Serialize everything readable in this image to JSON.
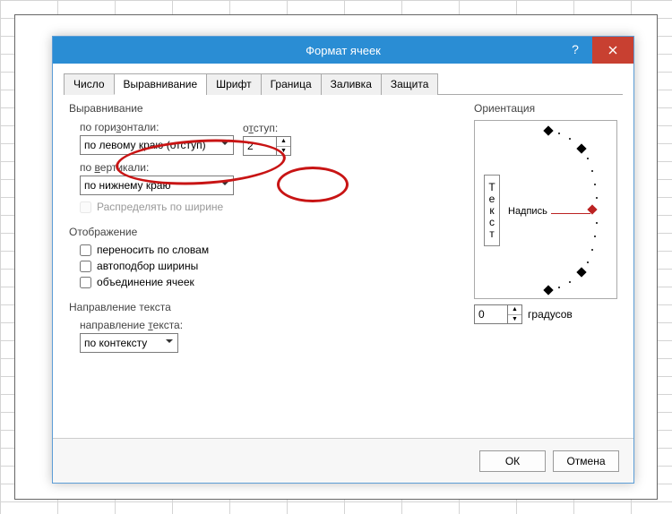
{
  "dialog": {
    "title": "Формат ячеек",
    "help": "?",
    "tabs": [
      "Число",
      "Выравнивание",
      "Шрифт",
      "Граница",
      "Заливка",
      "Защита"
    ],
    "active_tab": 1
  },
  "alignment": {
    "legend": "Выравнивание",
    "horiz_label": "по горизонтали:",
    "horiz_value": "по левому краю (отступ)",
    "indent_label": "отступ:",
    "indent_value": "2",
    "vert_label": "по вертикали:",
    "vert_value": "по нижнему краю",
    "justify_label": "Распределять по ширине"
  },
  "display": {
    "legend": "Отображение",
    "wrap_label": "переносить по словам",
    "autofit_label": "автоподбор ширины",
    "merge_label": "объединение ячеек"
  },
  "textdir": {
    "legend": "Направление текста",
    "label": "направление текста:",
    "value": "по контексту"
  },
  "orientation": {
    "legend": "Ориентация",
    "vert_text": "Текст",
    "label_text": "Надпись",
    "degrees_value": "0",
    "degrees_label": "градусов"
  },
  "buttons": {
    "ok": "ОК",
    "cancel": "Отмена"
  }
}
